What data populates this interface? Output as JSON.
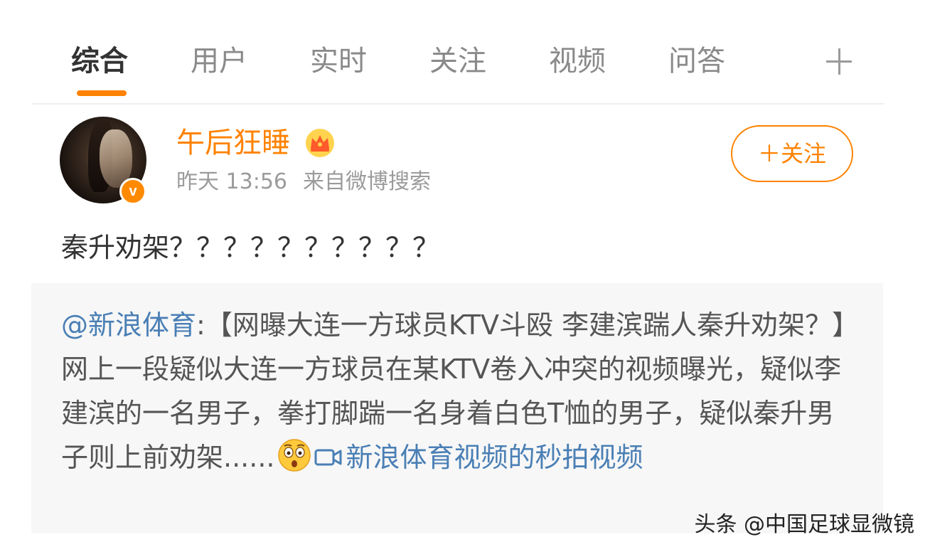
{
  "tabs": {
    "items": [
      {
        "label": "综合"
      },
      {
        "label": "用户"
      },
      {
        "label": "实时"
      },
      {
        "label": "关注"
      },
      {
        "label": "视频"
      },
      {
        "label": "问答"
      }
    ],
    "add_icon": "plus-icon"
  },
  "post": {
    "username": "午后狂睡",
    "badge_letter": "v",
    "time": "昨天 13:56",
    "source": "来自微博搜索",
    "follow_label": "＋关注",
    "text": "秦升劝架？？？？？？？？？？",
    "repost": {
      "mention": "@新浪体育",
      "body": ":【网曝大连一方球员KTV斗殴 李建滨踹人秦升劝架？】网上一段疑似大连一方球员在某KTV卷入冲突的视频曝光，疑似李建滨的一名男子，拳打脚踹一名身着白色T恤的男子，疑似秦升男子则上前劝架......",
      "emoji": "shocked-face-icon",
      "link_icon": "video-camera-icon",
      "link_text": "新浪体育视频的秒拍视频"
    }
  },
  "watermark": "头条 @中国足球显微镜",
  "colors": {
    "accent": "#ff8200",
    "link": "#4a7fb5",
    "repost_bg": "#f7f7f7"
  }
}
